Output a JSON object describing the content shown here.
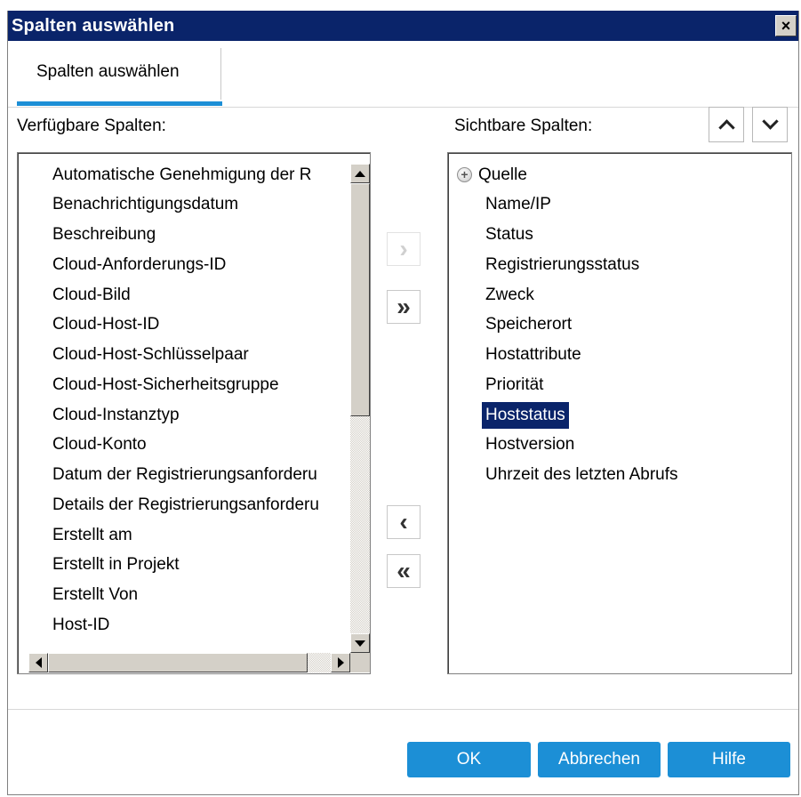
{
  "dialog": {
    "title": "Spalten auswählen",
    "close_symbol": "×",
    "accent_color": "#1c8fd6",
    "titlebar_color": "#0a246a"
  },
  "tab": {
    "label": "Spalten auswählen"
  },
  "available": {
    "label": "Verfügbare Spalten:",
    "items": [
      "Automatische Genehmigung der R",
      "Benachrichtigungsdatum",
      "Beschreibung",
      "Cloud-Anforderungs-ID",
      "Cloud-Bild",
      "Cloud-Host-ID",
      "Cloud-Host-Schlüsselpaar",
      "Cloud-Host-Sicherheitsgruppe",
      "Cloud-Instanztyp",
      "Cloud-Konto",
      "Datum der Registrierungsanforderu",
      "Details der Registrierungsanforderu",
      "Erstellt am",
      "Erstellt in Projekt",
      "Erstellt Von",
      "Host-ID"
    ]
  },
  "visible": {
    "label": "Sichtbare Spalten:",
    "items": [
      "Quelle",
      "Name/IP",
      "Status",
      "Registrierungsstatus",
      "Zweck",
      "Speicherort",
      "Hostattribute",
      "Priorität",
      "Hoststatus",
      "Hostversion",
      "Uhrzeit des letzten Abrufs"
    ],
    "selected_item": "Hoststatus",
    "expandable_item": "Quelle"
  },
  "move_buttons": {
    "add": "›",
    "add_all": "»",
    "remove": "‹",
    "remove_all": "«"
  },
  "icons": {
    "expand": "plus-circle-icon",
    "move_up": "chevron-up-icon",
    "move_down": "chevron-down-icon"
  },
  "footer": {
    "ok": "OK",
    "cancel": "Abbrechen",
    "help": "Hilfe"
  }
}
